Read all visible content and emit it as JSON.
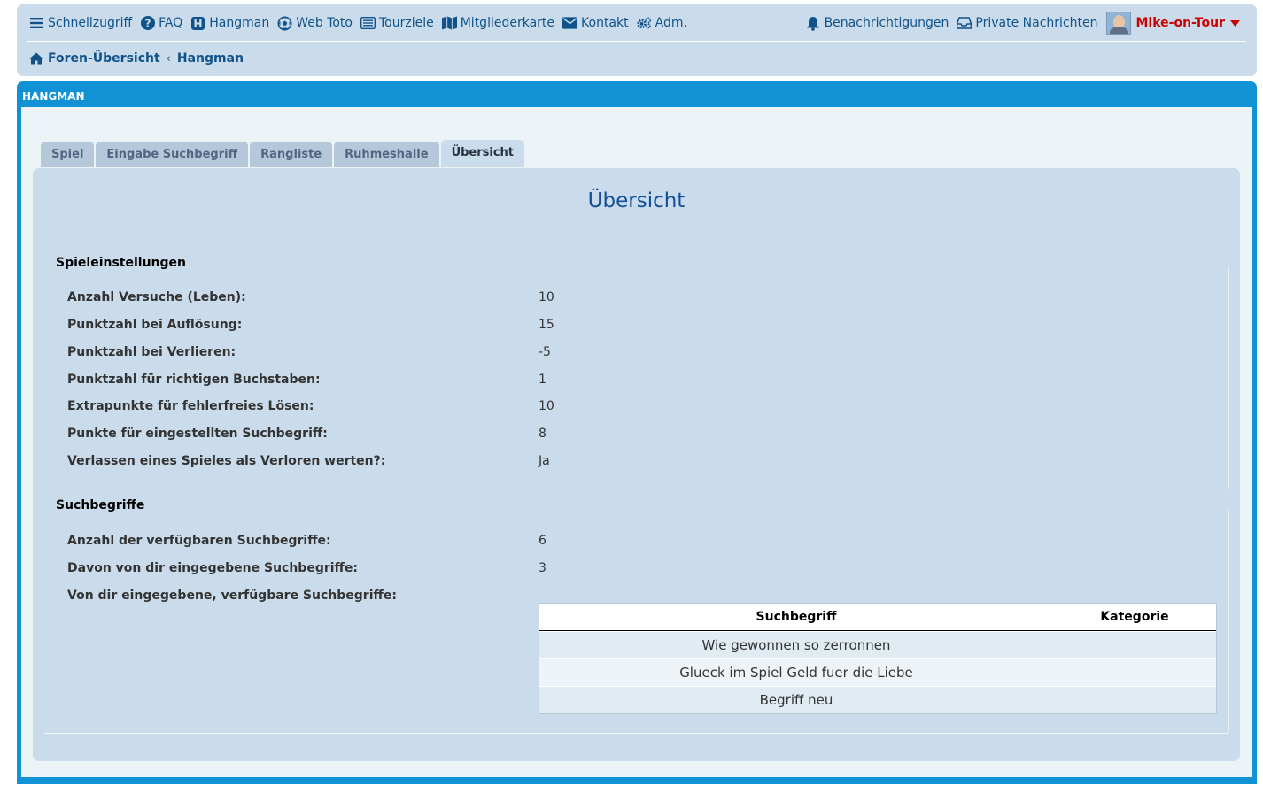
{
  "nav": {
    "items": [
      {
        "label": "Schnellzugriff",
        "icon": "bars-icon"
      },
      {
        "label": "FAQ",
        "icon": "question-circle-icon"
      },
      {
        "label": "Hangman",
        "icon": "h-square-icon"
      },
      {
        "label": "Web Toto",
        "icon": "soccer-ball-icon"
      },
      {
        "label": "Tourziele",
        "icon": "list-alt-icon"
      },
      {
        "label": "Mitgliederkarte",
        "icon": "map-icon"
      },
      {
        "label": "Kontakt",
        "icon": "envelope-icon"
      },
      {
        "label": "Adm.",
        "icon": "cogs-icon"
      }
    ],
    "notifications": "Benachrichtigungen",
    "private_messages": "Private Nachrichten",
    "username": "Mike-on-Tour"
  },
  "breadcrumb": {
    "home": "Foren-Übersicht",
    "current": "Hangman"
  },
  "forum_title": "HANGMAN",
  "tabs": [
    {
      "label": "Spiel",
      "active": false
    },
    {
      "label": "Eingabe Suchbegriff",
      "active": false
    },
    {
      "label": "Rangliste",
      "active": false
    },
    {
      "label": "Ruhmeshalle",
      "active": false
    },
    {
      "label": "Übersicht",
      "active": true
    }
  ],
  "page_title": "Übersicht",
  "settings": {
    "heading": "Spieleinstellungen",
    "rows": [
      {
        "label": "Anzahl Versuche (Leben):",
        "value": "10"
      },
      {
        "label": "Punktzahl bei Auflösung:",
        "value": "15"
      },
      {
        "label": "Punktzahl bei Verlieren:",
        "value": "-5"
      },
      {
        "label": "Punktzahl für richtigen Buchstaben:",
        "value": "1"
      },
      {
        "label": "Extrapunkte für fehlerfreies Lösen:",
        "value": "10"
      },
      {
        "label": "Punkte für eingestellten Suchbegriff:",
        "value": "8"
      },
      {
        "label": "Verlassen eines Spieles als Verloren werten?:",
        "value": "Ja"
      }
    ]
  },
  "terms": {
    "heading": "Suchbegriffe",
    "rows": [
      {
        "label": "Anzahl der verfügbaren Suchbegriffe:",
        "value": "6"
      },
      {
        "label": "Davon von dir eingegebene Suchbegriffe:",
        "value": "3"
      },
      {
        "label": "Von dir eingegebene, verfügbare Suchbegriffe:",
        "value": ""
      }
    ],
    "table": {
      "headers": [
        "Suchbegriff",
        "Kategorie"
      ],
      "rows": [
        [
          "Wie gewonnen so zerronnen",
          ""
        ],
        [
          "Glueck im Spiel Geld fuer die Liebe",
          ""
        ],
        [
          "Begriff neu",
          ""
        ]
      ]
    }
  },
  "colors": {
    "accent": "#105289",
    "header_bg": "#cadceb",
    "forum_blue": "#1192d4",
    "username": "#cc0000"
  }
}
